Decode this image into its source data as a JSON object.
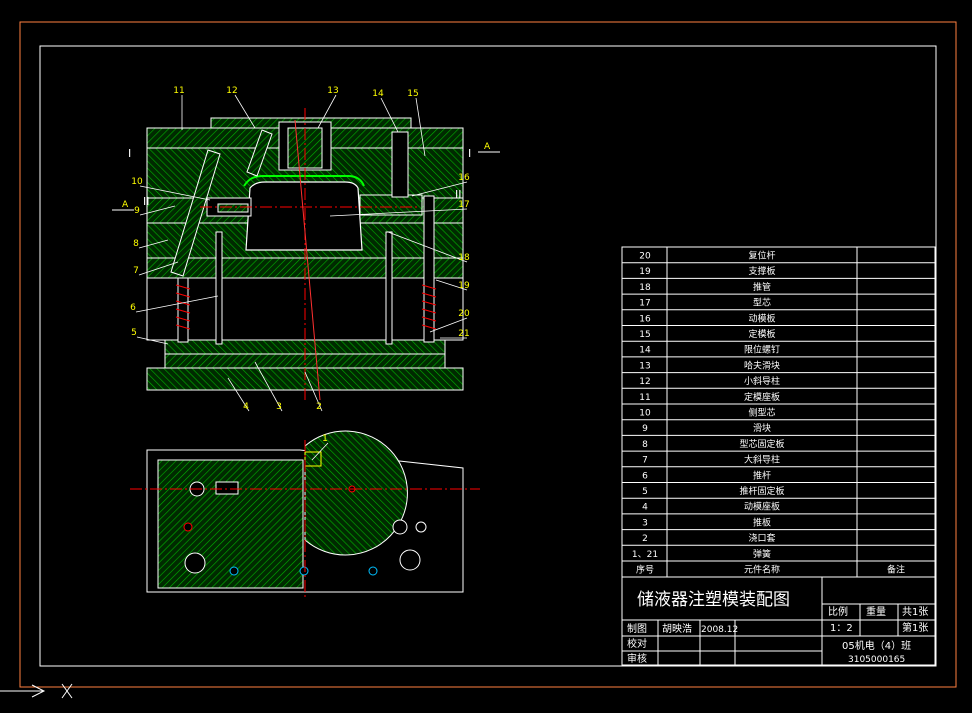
{
  "drawing": {
    "title": "储液器注塑模装配图",
    "section_marks": {
      "a_left": "A",
      "a_right": "A",
      "i_left": "I",
      "i_right": "I",
      "ii_left": "II",
      "ii_right": "II"
    },
    "callouts": [
      "1",
      "2",
      "3",
      "4",
      "5",
      "6",
      "7",
      "8",
      "9",
      "10",
      "11",
      "12",
      "13",
      "14",
      "15",
      "16",
      "17",
      "18",
      "19",
      "20",
      "21"
    ]
  },
  "bom": {
    "rows": [
      {
        "no": "20",
        "name": "复位杆"
      },
      {
        "no": "19",
        "name": "支撑板"
      },
      {
        "no": "18",
        "name": "推管"
      },
      {
        "no": "17",
        "name": "型芯"
      },
      {
        "no": "16",
        "name": "动模板"
      },
      {
        "no": "15",
        "name": "定模板"
      },
      {
        "no": "14",
        "name": "限位螺钉"
      },
      {
        "no": "13",
        "name": "哈夫滑块"
      },
      {
        "no": "12",
        "name": "小斜导柱"
      },
      {
        "no": "11",
        "name": "定模座板"
      },
      {
        "no": "10",
        "name": "侧型芯"
      },
      {
        "no": "9",
        "name": "滑块"
      },
      {
        "no": "8",
        "name": "型芯固定板"
      },
      {
        "no": "7",
        "name": "大斜导柱"
      },
      {
        "no": "6",
        "name": "推杆"
      },
      {
        "no": "5",
        "name": "推杆固定板"
      },
      {
        "no": "4",
        "name": "动模座板"
      },
      {
        "no": "3",
        "name": "推板"
      },
      {
        "no": "2",
        "name": "浇口套"
      },
      {
        "no": "1、21",
        "name": "弹簧"
      }
    ],
    "header": {
      "no": "序号",
      "name": "元件名称",
      "remark": "备注"
    }
  },
  "title_block": {
    "scale_label": "比例",
    "weight_label": "重量",
    "sheets_total": "共1张",
    "scale_value": "1：2",
    "sheet_no": "第1张",
    "drawn_label": "制图",
    "drawn_name": "胡映浩",
    "drawn_date": "2008.12",
    "check_label": "校对",
    "review_label": "审核",
    "class_name": "05机电（4）班",
    "student_no": "3105000165"
  },
  "colors": {
    "frame": "#ff8040",
    "hatch": "#00c000",
    "outline": "#ffffff",
    "centerline": "#ff0000",
    "leader": "#ffff00"
  }
}
